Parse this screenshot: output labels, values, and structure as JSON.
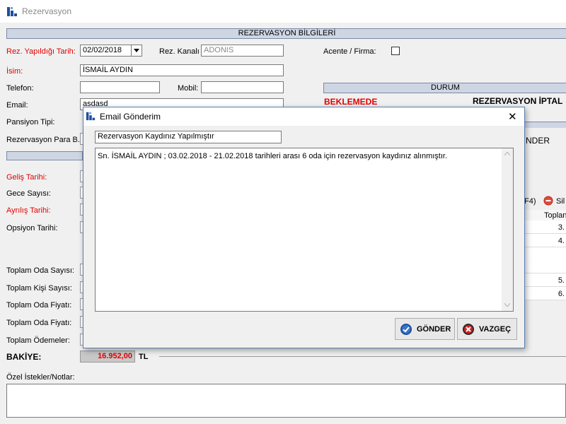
{
  "window": {
    "title": "Rezervasyon"
  },
  "section_header": "REZERVASYON BİLGİLERİ",
  "form": {
    "rez_date_label": "Rez. Yapıldığı Tarih:",
    "rez_date_value": "02/02/2018",
    "channel_label": "Rez. Kanalı",
    "channel_value": "ADONIS",
    "agency_label": "Acente / Firma:",
    "name_label": "İsim:",
    "name_value": "İSMAİL AYDIN",
    "phone_label": "Telefon:",
    "mobile_label": "Mobil:",
    "email_label": "Email:",
    "email_value": "asdasd",
    "pension_label": "Pansiyon Tipi:",
    "currency_label": "Rezervasyon Para B.",
    "arrival_label": "Geliş Tarihi:",
    "nights_label": "Gece Sayısı:",
    "departure_label": "Ayrılış Tarihi:",
    "option_label": "Opsiyon Tarihi:",
    "total_rooms_label": "Toplam Oda Sayısı:",
    "total_persons_label": "Toplam Kişi Sayısı:",
    "total_room_price_label1": "Toplam Oda Fiyatı:",
    "total_room_price_label2": "Toplam Oda Fiyatı:",
    "total_payments_label": "Toplam Ödemeler:",
    "balance_label": "BAKİYE:",
    "balance_value": "16.952,00",
    "balance_currency": "TL",
    "notes_label": "Özel İstekler/Notlar:"
  },
  "status": {
    "header": "DURUM",
    "pending": "BEKLEMEDE",
    "cancel": "REZERVASYON İPTAL",
    "partial_text": "NDER"
  },
  "grid": {
    "f4_text": "F4)",
    "delete_label": "Sil",
    "col_header": "Toplan",
    "rows": [
      "3.",
      "4.",
      "5.",
      "6."
    ]
  },
  "dialog": {
    "title": "Email Gönderim",
    "subject": "Rezervasyon Kaydınız Yapılmıştır",
    "body": "Sn. İSMAİL AYDIN ;  03.02.2018 - 21.02.2018 tarihleri arası 6 oda için rezervasyon kaydınız alınmıştır.",
    "send_label": "GÖNDER",
    "cancel_label": "VAZGEÇ",
    "close_glyph": "✕"
  },
  "colors": {
    "red_label": "#e00000",
    "header_bar": "#cfd6e3",
    "dialog_border": "#5a7fb4",
    "send_icon": "#1f4f9e",
    "cancel_icon": "#d62020"
  },
  "icons": {
    "app": "app-logo-icon",
    "dropdown": "dropdown-arrow-icon",
    "delete": "delete-icon",
    "send": "check-icon",
    "cancel": "cross-icon"
  }
}
